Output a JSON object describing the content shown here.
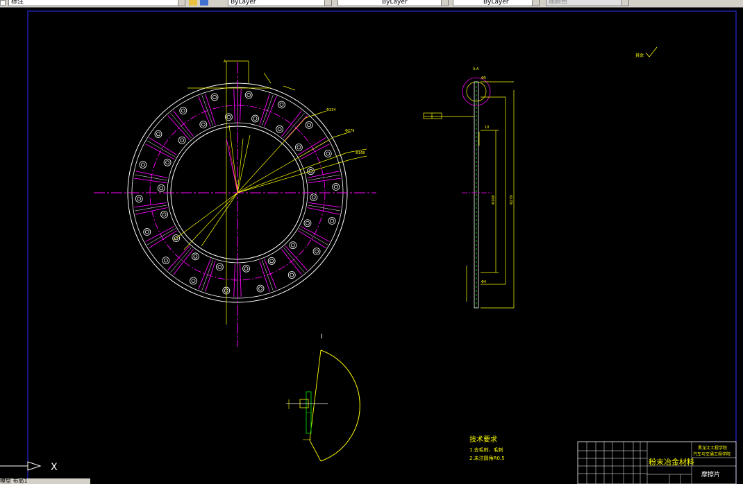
{
  "toolbar": {
    "layer_value": "标注",
    "color_value": "ByLayer",
    "linetype_value": "ByLayer",
    "lineweight_value": "ByLayer",
    "plotstyle_value": "随颜色"
  },
  "drawing": {
    "view_label_section": "A-A",
    "view_label_top": "A",
    "detail_label": "I",
    "roughness_note": "其余",
    "dims": {
      "d1": "Φ334",
      "d2": "Φ279",
      "d3": "Φ168",
      "side_top": "Φ5",
      "side_mid": "10",
      "side_inner": "Φ168",
      "side_outer": "Φ279",
      "side_bottom": "Φ4"
    }
  },
  "tech_requirements": {
    "title": "技术要求",
    "items": [
      "1.去毛刺、毛刺",
      "2.未注圆角R0.5"
    ]
  },
  "title_block": {
    "material": "粉末冶金材料",
    "school": "黑龙江工程学院",
    "department": "汽车与交通工程学院",
    "part_name": "摩擦片"
  },
  "status_bar": {
    "text": "模型 布局1"
  },
  "colors": {
    "background": "#000000",
    "magenta": "#ff00ff",
    "white": "#ffffff",
    "yellow": "#ffff00",
    "green": "#00c000",
    "blue_frame": "#3030ff"
  }
}
